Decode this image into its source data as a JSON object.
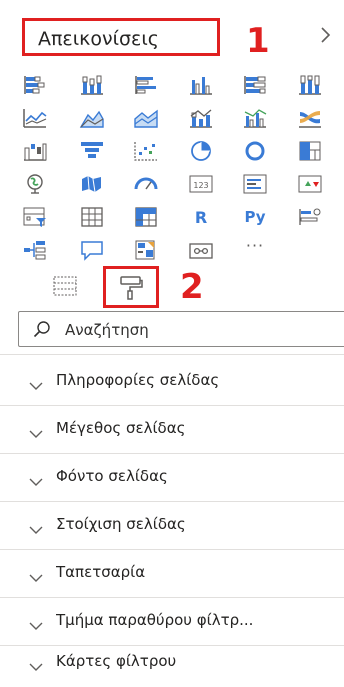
{
  "header": {
    "title": "Απεικονίσεις",
    "annotation_1": "1",
    "expand_icon": "chevron-right-icon"
  },
  "visuals": [
    {
      "name": "stacked-bar-chart-icon"
    },
    {
      "name": "stacked-column-chart-icon"
    },
    {
      "name": "clustered-bar-chart-icon"
    },
    {
      "name": "clustered-column-chart-icon"
    },
    {
      "name": "100-stacked-bar-chart-icon"
    },
    {
      "name": "100-stacked-column-chart-icon"
    },
    {
      "name": "line-chart-icon"
    },
    {
      "name": "area-chart-icon"
    },
    {
      "name": "stacked-area-chart-icon"
    },
    {
      "name": "line-and-stacked-column-chart-icon"
    },
    {
      "name": "line-and-clustered-column-chart-icon"
    },
    {
      "name": "ribbon-chart-icon"
    },
    {
      "name": "waterfall-chart-icon"
    },
    {
      "name": "funnel-chart-icon"
    },
    {
      "name": "scatter-chart-icon"
    },
    {
      "name": "pie-chart-icon"
    },
    {
      "name": "donut-chart-icon"
    },
    {
      "name": "treemap-icon"
    },
    {
      "name": "map-icon"
    },
    {
      "name": "filled-map-icon"
    },
    {
      "name": "gauge-icon"
    },
    {
      "name": "card-icon",
      "text": "123"
    },
    {
      "name": "multi-row-card-icon"
    },
    {
      "name": "kpi-icon"
    },
    {
      "name": "slicer-icon"
    },
    {
      "name": "table-icon"
    },
    {
      "name": "matrix-icon"
    },
    {
      "name": "r-script-visual-icon",
      "text": "R"
    },
    {
      "name": "python-visual-icon",
      "text": "Py"
    },
    {
      "name": "key-influencers-icon"
    },
    {
      "name": "decomposition-tree-icon"
    },
    {
      "name": "qa-icon"
    },
    {
      "name": "smart-narrative-icon"
    },
    {
      "name": "paginated-report-icon"
    },
    {
      "name": "more-visuals-icon",
      "text": "···"
    }
  ],
  "build": {
    "fields_icon": "fields-icon",
    "format_icon": "paint-roller-icon",
    "annotation_2": "2"
  },
  "search": {
    "placeholder": "Αναζήτηση"
  },
  "sections": [
    {
      "label": "Πληροφορίες σελίδας"
    },
    {
      "label": "Μέγεθος σελίδας"
    },
    {
      "label": "Φόντο σελίδας"
    },
    {
      "label": "Στοίχιση σελίδας"
    },
    {
      "label": "Ταπετσαρία"
    },
    {
      "label": "Τμήμα παραθύρου φίλτρ..."
    },
    {
      "label": "Κάρτες φίλτρου"
    }
  ],
  "colors": {
    "highlight": "#e02020",
    "blue": "#3a7bd5",
    "green": "#44a35a",
    "teal": "#118dff",
    "text": "#252423",
    "divider": "#e1dfdd"
  }
}
